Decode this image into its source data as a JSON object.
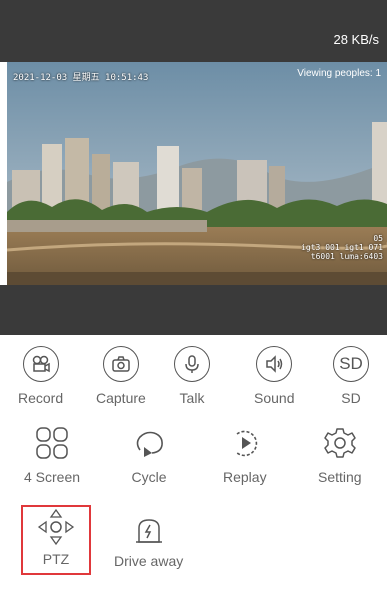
{
  "status": {
    "speed": "28 KB/s"
  },
  "video": {
    "osd_time": "2021-12-03 星期五 10:51:43",
    "viewers": "Viewing peoples: 1",
    "osd_stats": "05\nigt3 001 igt1 071\nt6001 luma:6403"
  },
  "controls": {
    "record": "Record",
    "capture": "Capture",
    "talk": "Talk",
    "sound": "Sound",
    "sd": "SD",
    "sd_icon_text": "SD",
    "four_screen": "4 Screen",
    "cycle": "Cycle",
    "replay": "Replay",
    "setting": "Setting",
    "ptz": "PTZ",
    "drive_away": "Drive away"
  },
  "colors": {
    "highlight": "#e0383b",
    "dark_bar": "#3a3a3a",
    "label": "#666666"
  }
}
